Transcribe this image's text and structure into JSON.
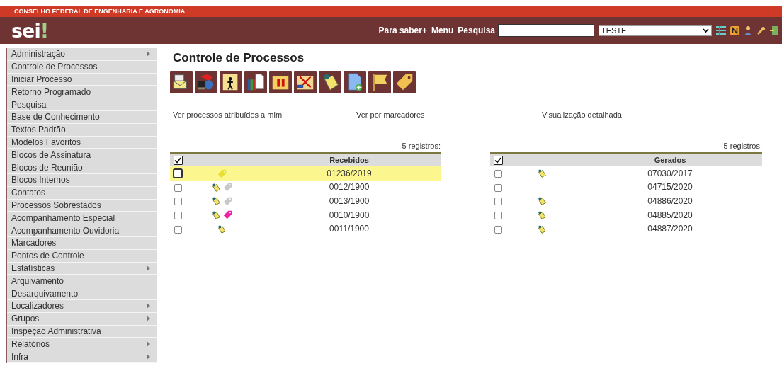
{
  "header": {
    "organization": "CONSELHO FEDERAL DE ENGENHARIA E AGRONOMIA",
    "logo": {
      "text": "sei",
      "mark": "!"
    },
    "links": [
      "Para saber+",
      "Menu",
      "Pesquisa"
    ],
    "unit_select": {
      "value": "TESTE"
    }
  },
  "sidebar": {
    "items": [
      {
        "label": "Administração",
        "submenu": true
      },
      {
        "label": "Controle de Processos",
        "submenu": false
      },
      {
        "label": "Iniciar Processo",
        "submenu": false
      },
      {
        "label": "Retorno Programado",
        "submenu": false
      },
      {
        "label": "Pesquisa",
        "submenu": false
      },
      {
        "label": "Base de Conhecimento",
        "submenu": false
      },
      {
        "label": "Textos Padrão",
        "submenu": false
      },
      {
        "label": "Modelos Favoritos",
        "submenu": false
      },
      {
        "label": "Blocos de Assinatura",
        "submenu": false
      },
      {
        "label": "Blocos de Reunião",
        "submenu": false
      },
      {
        "label": "Blocos Internos",
        "submenu": false
      },
      {
        "label": "Contatos",
        "submenu": false
      },
      {
        "label": "Processos Sobrestados",
        "submenu": false
      },
      {
        "label": "Acompanhamento Especial",
        "submenu": false
      },
      {
        "label": "Acompanhamento Ouvidoria",
        "submenu": false
      },
      {
        "label": "Marcadores",
        "submenu": false
      },
      {
        "label": "Pontos de Controle",
        "submenu": false
      },
      {
        "label": "Estatísticas",
        "submenu": true
      },
      {
        "label": "Arquivamento",
        "submenu": false
      },
      {
        "label": "Desarquivamento",
        "submenu": false
      },
      {
        "label": "Localizadores",
        "submenu": true
      },
      {
        "label": "Grupos",
        "submenu": true
      },
      {
        "label": "Inspeção Administrativa",
        "submenu": false
      },
      {
        "label": "Relatórios",
        "submenu": true
      },
      {
        "label": "Infra",
        "submenu": true
      }
    ]
  },
  "main": {
    "title": "Controle de Processos",
    "view_links": [
      "Ver processos atribuídos a mim",
      "Ver por marcadores",
      "Visualização detalhada"
    ],
    "tables": [
      {
        "count": "5 registros:",
        "heading": "Recebidos",
        "all_checked": true,
        "rows": [
          {
            "number": "01236/2019",
            "checked": false,
            "selected": true,
            "note": false,
            "tag": {
              "color": "#e8e030"
            }
          },
          {
            "number": "0012/1900",
            "checked": false,
            "selected": false,
            "note": true,
            "tag": {
              "color": "#c8c8c8"
            }
          },
          {
            "number": "0013/1900",
            "checked": false,
            "selected": false,
            "note": true,
            "tag": {
              "color": "#c8c8c8"
            }
          },
          {
            "number": "0010/1900",
            "checked": false,
            "selected": false,
            "note": true,
            "tag": {
              "color": "#f020a8"
            }
          },
          {
            "number": "0011/1900",
            "checked": false,
            "selected": false,
            "note": true
          }
        ]
      },
      {
        "count": "5 registros:",
        "heading": "Gerados",
        "all_checked": true,
        "rows": [
          {
            "number": "07030/2017",
            "checked": false,
            "selected": false,
            "note": true
          },
          {
            "number": "04715/2020",
            "checked": false,
            "selected": false,
            "note": false
          },
          {
            "number": "04886/2020",
            "checked": false,
            "selected": false,
            "note": true
          },
          {
            "number": "04885/2020",
            "checked": false,
            "selected": false,
            "note": true
          },
          {
            "number": "04887/2020",
            "checked": false,
            "selected": false,
            "note": true
          }
        ]
      }
    ]
  }
}
